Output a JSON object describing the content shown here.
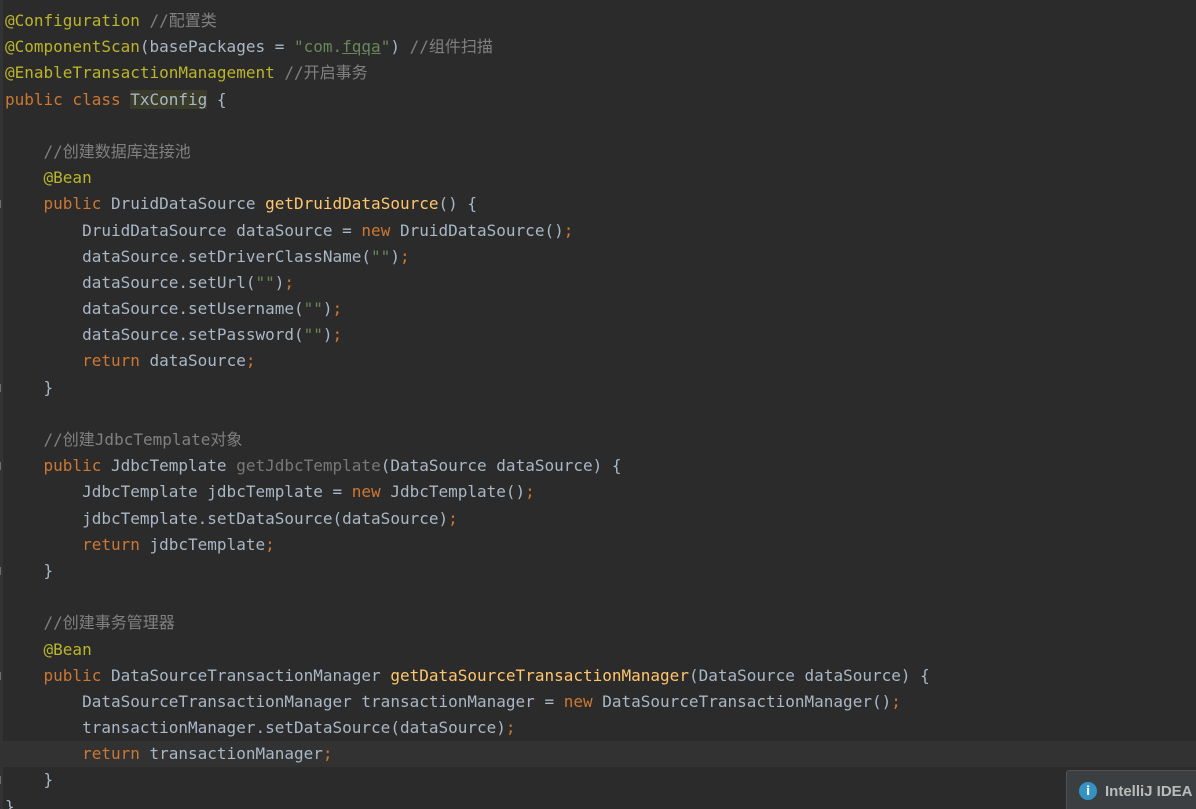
{
  "editor": {
    "lines": [
      {
        "fold": false,
        "current": false,
        "tokens": [
          {
            "t": "@Configuration",
            "c": "ann"
          },
          {
            "t": " ",
            "c": "plain"
          },
          {
            "t": "//配置类",
            "c": "cmt"
          }
        ]
      },
      {
        "fold": false,
        "current": false,
        "tokens": [
          {
            "t": "@ComponentScan",
            "c": "ann"
          },
          {
            "t": "(basePackages = ",
            "c": "plain"
          },
          {
            "t": "\"com.",
            "c": "str"
          },
          {
            "t": "fqqa",
            "c": "typo"
          },
          {
            "t": "\"",
            "c": "str"
          },
          {
            "t": ") ",
            "c": "plain"
          },
          {
            "t": "//组件扫描",
            "c": "cmt"
          }
        ]
      },
      {
        "fold": false,
        "current": false,
        "tokens": [
          {
            "t": "@EnableTransactionManagement",
            "c": "ann"
          },
          {
            "t": " ",
            "c": "plain"
          },
          {
            "t": "//开启事务",
            "c": "cmt"
          }
        ]
      },
      {
        "fold": false,
        "current": false,
        "tokens": [
          {
            "t": "public class ",
            "c": "kw"
          },
          {
            "t": "TxConfig",
            "c": "cls-hl"
          },
          {
            "t": " {",
            "c": "plain"
          }
        ]
      },
      {
        "fold": false,
        "current": false,
        "tokens": []
      },
      {
        "fold": false,
        "current": false,
        "tokens": [
          {
            "t": "    ",
            "c": "plain"
          },
          {
            "t": "//创建数据库连接池",
            "c": "cmt"
          }
        ]
      },
      {
        "fold": false,
        "current": false,
        "tokens": [
          {
            "t": "    ",
            "c": "plain"
          },
          {
            "t": "@Bean",
            "c": "ann"
          }
        ]
      },
      {
        "fold": true,
        "current": false,
        "tokens": [
          {
            "t": "    ",
            "c": "plain"
          },
          {
            "t": "public ",
            "c": "kw"
          },
          {
            "t": "DruidDataSource ",
            "c": "plain"
          },
          {
            "t": "getDruidDataSource",
            "c": "fn"
          },
          {
            "t": "() {",
            "c": "plain"
          }
        ]
      },
      {
        "fold": false,
        "current": false,
        "tokens": [
          {
            "t": "        DruidDataSource dataSource = ",
            "c": "plain"
          },
          {
            "t": "new ",
            "c": "kw"
          },
          {
            "t": "DruidDataSource()",
            "c": "plain"
          },
          {
            "t": ";",
            "c": "punc"
          }
        ]
      },
      {
        "fold": false,
        "current": false,
        "tokens": [
          {
            "t": "        dataSource.setDriverClassName(",
            "c": "plain"
          },
          {
            "t": "\"\"",
            "c": "str"
          },
          {
            "t": ")",
            "c": "plain"
          },
          {
            "t": ";",
            "c": "punc"
          }
        ]
      },
      {
        "fold": false,
        "current": false,
        "tokens": [
          {
            "t": "        dataSource.setUrl(",
            "c": "plain"
          },
          {
            "t": "\"\"",
            "c": "str"
          },
          {
            "t": ")",
            "c": "plain"
          },
          {
            "t": ";",
            "c": "punc"
          }
        ]
      },
      {
        "fold": false,
        "current": false,
        "tokens": [
          {
            "t": "        dataSource.setUsername(",
            "c": "plain"
          },
          {
            "t": "\"\"",
            "c": "str"
          },
          {
            "t": ")",
            "c": "plain"
          },
          {
            "t": ";",
            "c": "punc"
          }
        ]
      },
      {
        "fold": false,
        "current": false,
        "tokens": [
          {
            "t": "        dataSource.setPassword(",
            "c": "plain"
          },
          {
            "t": "\"\"",
            "c": "str"
          },
          {
            "t": ")",
            "c": "plain"
          },
          {
            "t": ";",
            "c": "punc"
          }
        ]
      },
      {
        "fold": false,
        "current": false,
        "tokens": [
          {
            "t": "        ",
            "c": "plain"
          },
          {
            "t": "return ",
            "c": "kw"
          },
          {
            "t": "dataSource",
            "c": "plain"
          },
          {
            "t": ";",
            "c": "punc"
          }
        ]
      },
      {
        "fold": true,
        "current": false,
        "tokens": [
          {
            "t": "    }",
            "c": "plain"
          }
        ]
      },
      {
        "fold": false,
        "current": false,
        "tokens": []
      },
      {
        "fold": false,
        "current": false,
        "tokens": [
          {
            "t": "    ",
            "c": "plain"
          },
          {
            "t": "//创建JdbcTemplate对象",
            "c": "cmt"
          }
        ]
      },
      {
        "fold": true,
        "current": false,
        "tokens": [
          {
            "t": "    ",
            "c": "plain"
          },
          {
            "t": "public ",
            "c": "kw"
          },
          {
            "t": "JdbcTemplate ",
            "c": "plain"
          },
          {
            "t": "getJdbcTemplate",
            "c": "unused"
          },
          {
            "t": "(DataSource dataSource) {",
            "c": "plain"
          }
        ]
      },
      {
        "fold": false,
        "current": false,
        "tokens": [
          {
            "t": "        JdbcTemplate jdbcTemplate = ",
            "c": "plain"
          },
          {
            "t": "new ",
            "c": "kw"
          },
          {
            "t": "JdbcTemplate()",
            "c": "plain"
          },
          {
            "t": ";",
            "c": "punc"
          }
        ]
      },
      {
        "fold": false,
        "current": false,
        "tokens": [
          {
            "t": "        jdbcTemplate.setDataSource(dataSource)",
            "c": "plain"
          },
          {
            "t": ";",
            "c": "punc"
          }
        ]
      },
      {
        "fold": false,
        "current": false,
        "tokens": [
          {
            "t": "        ",
            "c": "plain"
          },
          {
            "t": "return ",
            "c": "kw"
          },
          {
            "t": "jdbcTemplate",
            "c": "plain"
          },
          {
            "t": ";",
            "c": "punc"
          }
        ]
      },
      {
        "fold": true,
        "current": false,
        "tokens": [
          {
            "t": "    }",
            "c": "plain"
          }
        ]
      },
      {
        "fold": false,
        "current": false,
        "tokens": []
      },
      {
        "fold": false,
        "current": false,
        "tokens": [
          {
            "t": "    ",
            "c": "plain"
          },
          {
            "t": "//创建事务管理器",
            "c": "cmt"
          }
        ]
      },
      {
        "fold": false,
        "current": false,
        "tokens": [
          {
            "t": "    ",
            "c": "plain"
          },
          {
            "t": "@Bean",
            "c": "ann"
          }
        ]
      },
      {
        "fold": true,
        "current": false,
        "tokens": [
          {
            "t": "    ",
            "c": "plain"
          },
          {
            "t": "public ",
            "c": "kw"
          },
          {
            "t": "DataSourceTransactionManager ",
            "c": "plain"
          },
          {
            "t": "getDataSourceTransactionManager",
            "c": "fn"
          },
          {
            "t": "(DataSource dataSource) {",
            "c": "plain"
          }
        ]
      },
      {
        "fold": false,
        "current": false,
        "tokens": [
          {
            "t": "        DataSourceTransactionManager transactionManager = ",
            "c": "plain"
          },
          {
            "t": "new ",
            "c": "kw"
          },
          {
            "t": "DataSourceTransactionManager()",
            "c": "plain"
          },
          {
            "t": ";",
            "c": "punc"
          }
        ]
      },
      {
        "fold": false,
        "current": false,
        "tokens": [
          {
            "t": "        transactionManager.setDataSource(dataSource)",
            "c": "plain"
          },
          {
            "t": ";",
            "c": "punc"
          }
        ]
      },
      {
        "fold": false,
        "current": true,
        "tokens": [
          {
            "t": "        ",
            "c": "plain"
          },
          {
            "t": "return ",
            "c": "kw"
          },
          {
            "t": "transactionManager",
            "c": "plain"
          },
          {
            "t": ";",
            "c": "punc"
          }
        ]
      },
      {
        "fold": true,
        "current": false,
        "tokens": [
          {
            "t": "    }",
            "c": "plain"
          }
        ]
      },
      {
        "fold": false,
        "current": false,
        "tokens": [
          {
            "t": "}",
            "c": "plain"
          }
        ]
      }
    ]
  },
  "notification": {
    "icon": "info-icon",
    "icon_glyph": "i",
    "text": "IntelliJ IDEA"
  }
}
